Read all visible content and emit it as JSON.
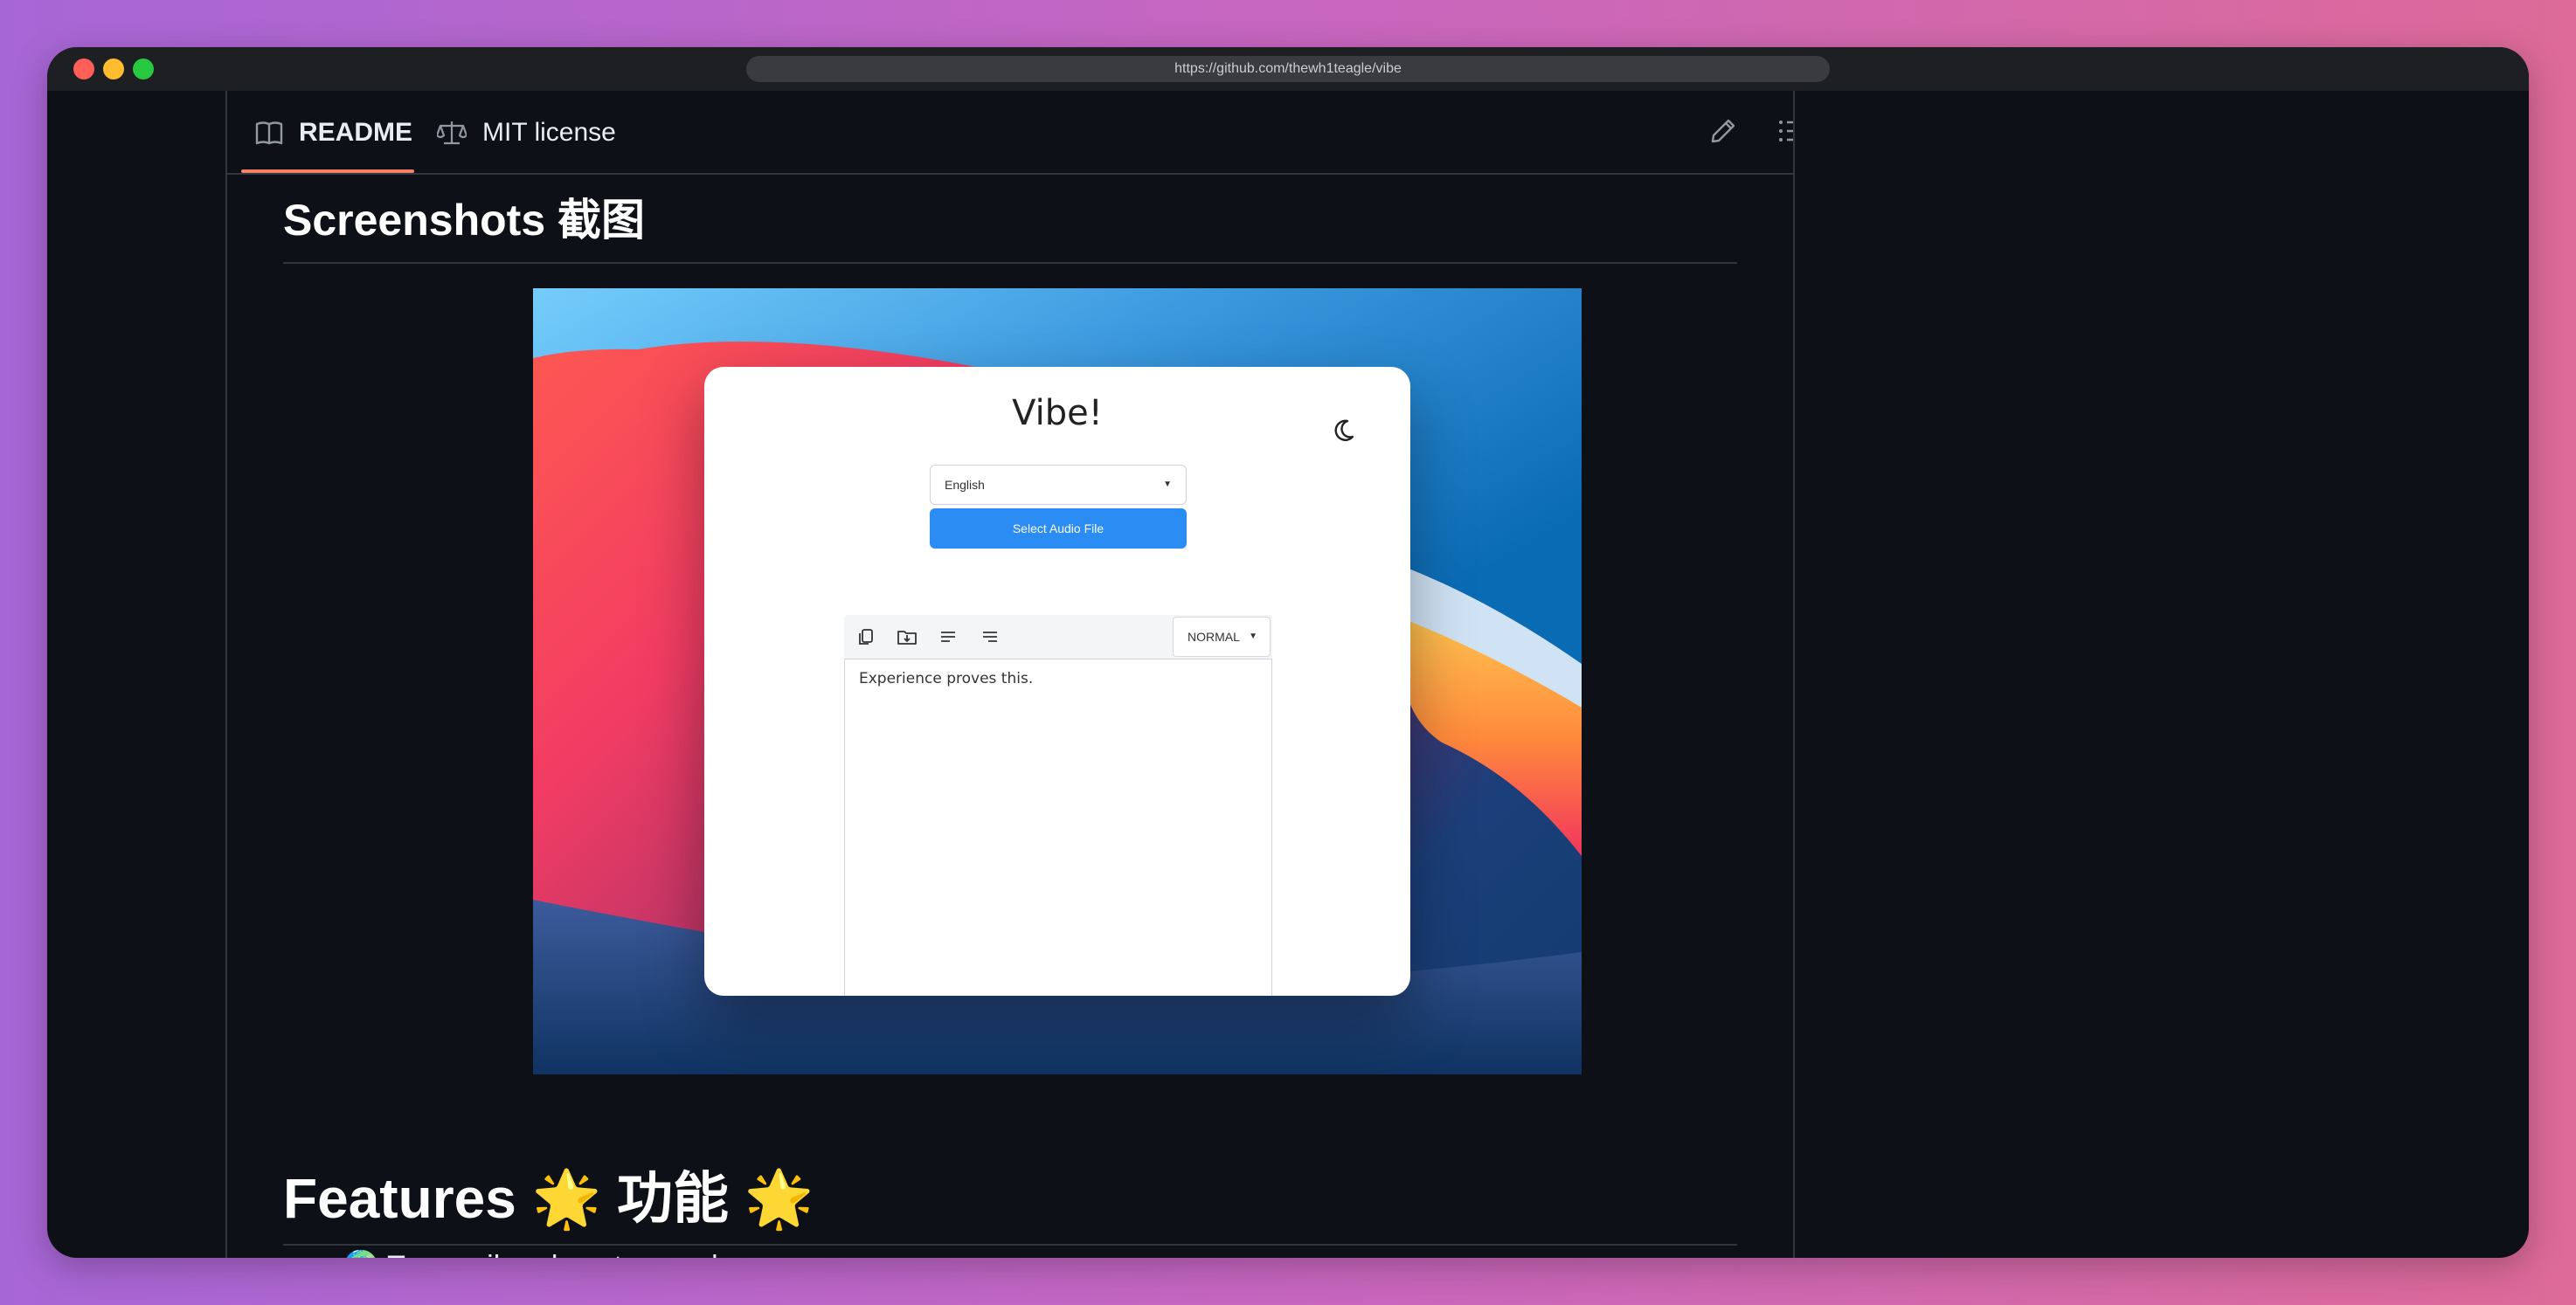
{
  "browser": {
    "url": "https://github.com/thewh1teagle/vibe"
  },
  "tabs": {
    "readme": "README",
    "license": "MIT license"
  },
  "headings": {
    "screenshots": "Screenshots 截图",
    "features": "Features 🌟 功能 🌟"
  },
  "features_list": {
    "first_item": "🌍 Transcribe almost every language"
  },
  "app": {
    "title": "Vibe!",
    "language_value": "English",
    "select_audio_label": "Select Audio File",
    "mode_value": "NORMAL",
    "transcript_text": "Experience proves this."
  },
  "icons": {
    "readme_tab": "book-icon",
    "license_tab": "scale-icon",
    "edit": "pencil-icon",
    "outline": "list-icon",
    "theme": "moon-icon",
    "copy": "copy-icon",
    "download": "download-icon",
    "align_left": "align-left-icon",
    "align_right": "align-right-icon"
  },
  "colors": {
    "tab_underline": "#f78166",
    "page_bg": "#0d1117",
    "primary_button": "#2b8cf3"
  }
}
